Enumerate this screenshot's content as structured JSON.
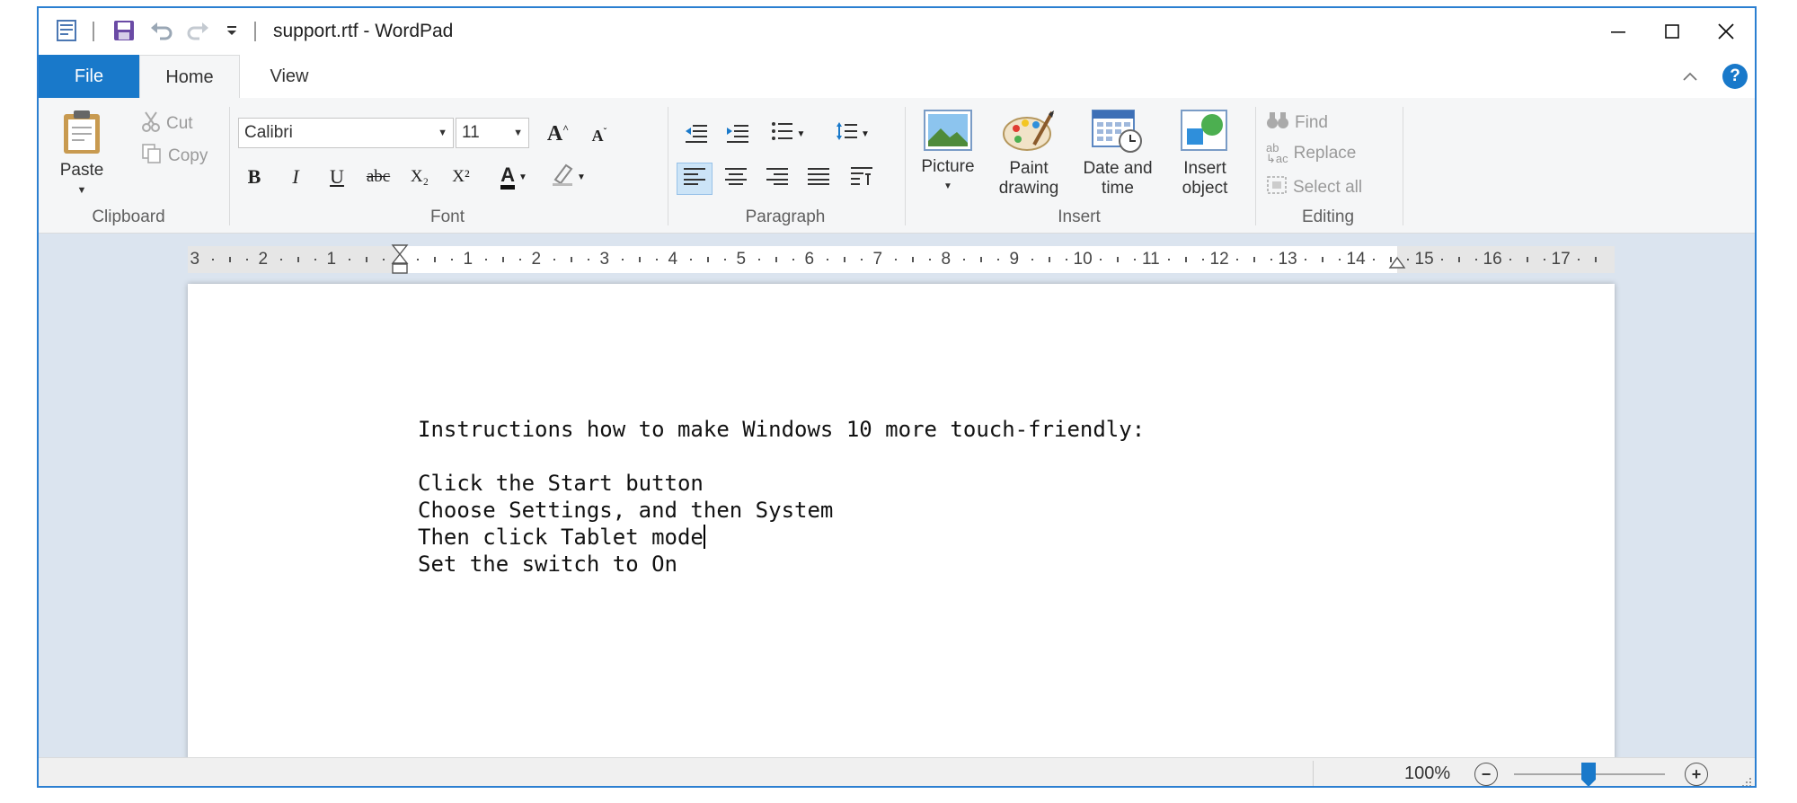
{
  "window": {
    "title": "support.rtf - WordPad"
  },
  "quick_access": {
    "icons": [
      "wordpad-app-icon",
      "save-icon",
      "undo-icon",
      "redo-icon",
      "customize-qat-icon"
    ]
  },
  "tabs": [
    {
      "label": "File"
    },
    {
      "label": "Home"
    },
    {
      "label": "View"
    }
  ],
  "ribbon": {
    "clipboard": {
      "group_label": "Clipboard",
      "paste_label": "Paste",
      "cut_label": "Cut",
      "copy_label": "Copy"
    },
    "font": {
      "group_label": "Font",
      "font_name": "Calibri",
      "font_size": "11",
      "bold_glyph": "B",
      "italic_glyph": "I",
      "underline_glyph": "U",
      "strike_glyph": "abc",
      "subscript_glyph": "X₂",
      "superscript_glyph": "X²",
      "color_glyph": "A"
    },
    "paragraph": {
      "group_label": "Paragraph"
    },
    "insert": {
      "group_label": "Insert",
      "picture_label": "Picture",
      "paint_label_1": "Paint",
      "paint_label_2": "drawing",
      "datetime_label_1": "Date and",
      "datetime_label_2": "time",
      "object_label_1": "Insert",
      "object_label_2": "object"
    },
    "editing": {
      "group_label": "Editing",
      "find_label": "Find",
      "replace_label": "Replace",
      "select_all_label": "Select all"
    }
  },
  "ruler": {
    "left_numbers": [
      "3",
      "2",
      "1"
    ],
    "right_numbers": [
      "1",
      "2",
      "3",
      "4",
      "5",
      "6",
      "7",
      "8",
      "9",
      "10",
      "11",
      "12",
      "13",
      "14",
      "15",
      "16",
      "17"
    ]
  },
  "document": {
    "lines": [
      "Instructions how to make Windows 10 more touch-friendly:",
      "",
      "Click the Start button",
      "Choose Settings, and then System",
      "Then click Tablet mode",
      "Set the switch to On"
    ]
  },
  "status": {
    "zoom": "100%",
    "zoom_level": 1.0
  },
  "colors": {
    "accent": "#1979ca",
    "ribbon_bg": "#f5f6f7",
    "doc_bg": "#dbe4ef"
  }
}
